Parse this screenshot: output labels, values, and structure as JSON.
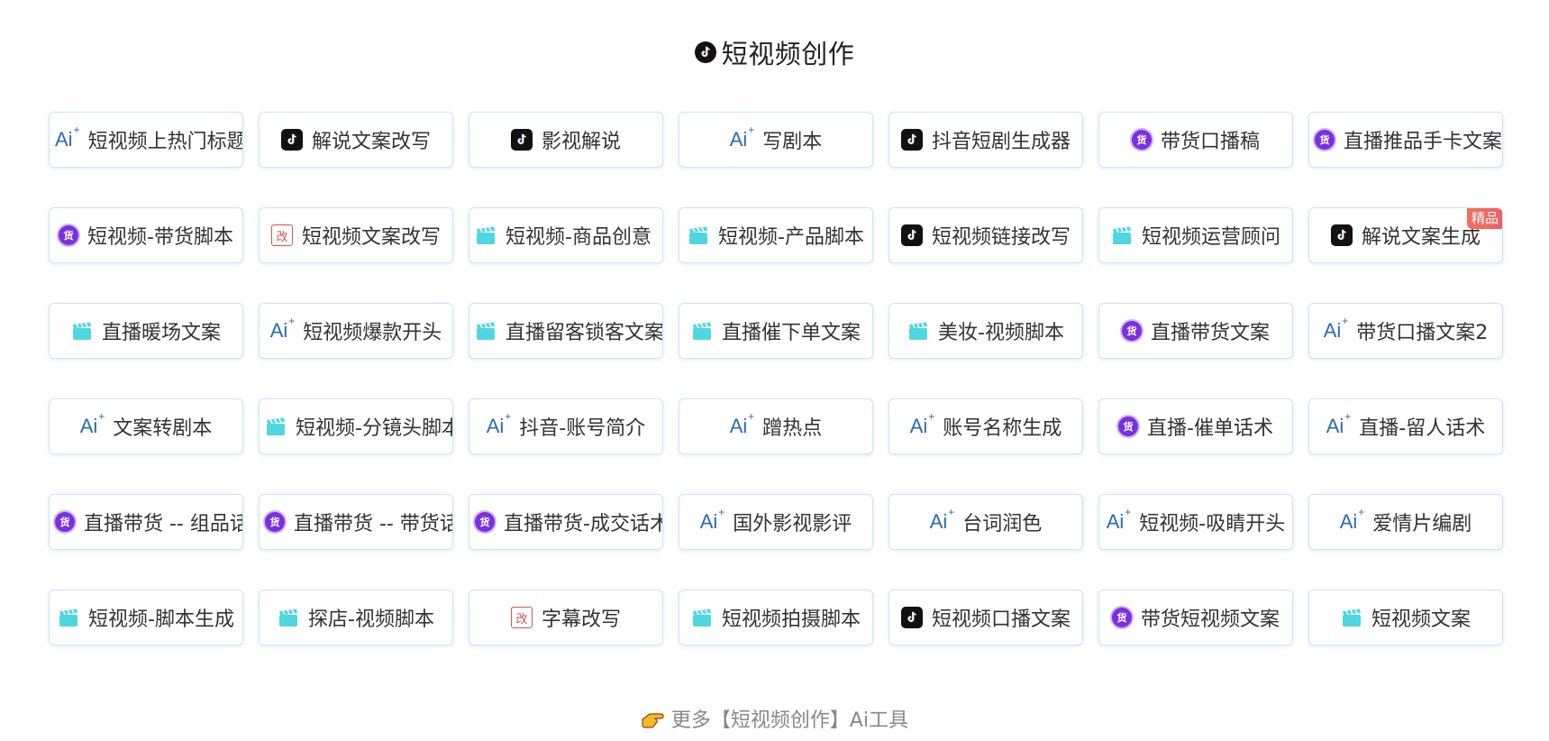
{
  "header": {
    "icon": "tiktok-logo-icon",
    "title": "短视频创作"
  },
  "cards": [
    {
      "icon": "ai",
      "label": "短视频上热门标题",
      "align": "left"
    },
    {
      "icon": "tiktok",
      "label": "解说文案改写"
    },
    {
      "icon": "tiktok",
      "label": "影视解说"
    },
    {
      "icon": "ai",
      "label": "写剧本"
    },
    {
      "icon": "tiktok",
      "label": "抖音短剧生成器"
    },
    {
      "icon": "huo",
      "label": "带货口播稿"
    },
    {
      "icon": "huo",
      "label": "直播推品手卡文案",
      "align": "left"
    },
    {
      "icon": "huo",
      "label": "短视频-带货脚本"
    },
    {
      "icon": "gai",
      "label": "短视频文案改写"
    },
    {
      "icon": "clap",
      "label": "短视频-商品创意",
      "align": "left"
    },
    {
      "icon": "clap",
      "label": "短视频-产品脚本"
    },
    {
      "icon": "tiktok",
      "label": "短视频链接改写"
    },
    {
      "icon": "clap",
      "label": "短视频运营顾问"
    },
    {
      "icon": "tiktok",
      "label": "解说文案生成",
      "badge": "精品"
    },
    {
      "icon": "clap",
      "label": "直播暖场文案"
    },
    {
      "icon": "ai",
      "label": "短视频爆款开头"
    },
    {
      "icon": "clap",
      "label": "直播留客锁客文案",
      "align": "left"
    },
    {
      "icon": "clap",
      "label": "直播催下单文案"
    },
    {
      "icon": "clap",
      "label": "美妆-视频脚本"
    },
    {
      "icon": "huo",
      "label": "直播带货文案"
    },
    {
      "icon": "ai",
      "label": "带货口播文案2"
    },
    {
      "icon": "ai",
      "label": "文案转剧本"
    },
    {
      "icon": "clap",
      "label": "短视频-分镜头脚本",
      "align": "left"
    },
    {
      "icon": "ai",
      "label": "抖音-账号简介"
    },
    {
      "icon": "ai",
      "label": "蹭热点"
    },
    {
      "icon": "ai",
      "label": "账号名称生成"
    },
    {
      "icon": "huo",
      "label": "直播-催单话术"
    },
    {
      "icon": "ai",
      "label": "直播-留人话术"
    },
    {
      "icon": "huo",
      "label": "直播带货 -- 组品话术",
      "align": "left"
    },
    {
      "icon": "huo",
      "label": "直播带货 -- 带货话术",
      "align": "left"
    },
    {
      "icon": "huo",
      "label": "直播带货-成交话术",
      "align": "left"
    },
    {
      "icon": "ai",
      "label": "国外影视影评"
    },
    {
      "icon": "ai",
      "label": "台词润色"
    },
    {
      "icon": "ai",
      "label": "短视频-吸睛开头"
    },
    {
      "icon": "ai",
      "label": "爱情片编剧"
    },
    {
      "icon": "clap",
      "label": "短视频-脚本生成"
    },
    {
      "icon": "clap",
      "label": "探店-视频脚本"
    },
    {
      "icon": "gai",
      "label": "字幕改写"
    },
    {
      "icon": "clap",
      "label": "短视频拍摄脚本"
    },
    {
      "icon": "tiktok",
      "label": "短视频口播文案"
    },
    {
      "icon": "huo",
      "label": "带货短视频文案"
    },
    {
      "icon": "clap",
      "label": "短视频文案"
    }
  ],
  "icon_glyphs": {
    "ai": "Ai",
    "huo": "货",
    "gai": "改"
  },
  "more": {
    "icon": "pointing-hand-icon",
    "label": "更多【短视频创作】Ai工具"
  },
  "colors": {
    "ai_blue": "#2b6cb0",
    "huo_purple": "#7a2fe0",
    "clap_cyan": "#4fd6e0",
    "gai_red": "#d9534f",
    "badge_red": "#ef5f68",
    "card_border": "#cfe3fb"
  }
}
